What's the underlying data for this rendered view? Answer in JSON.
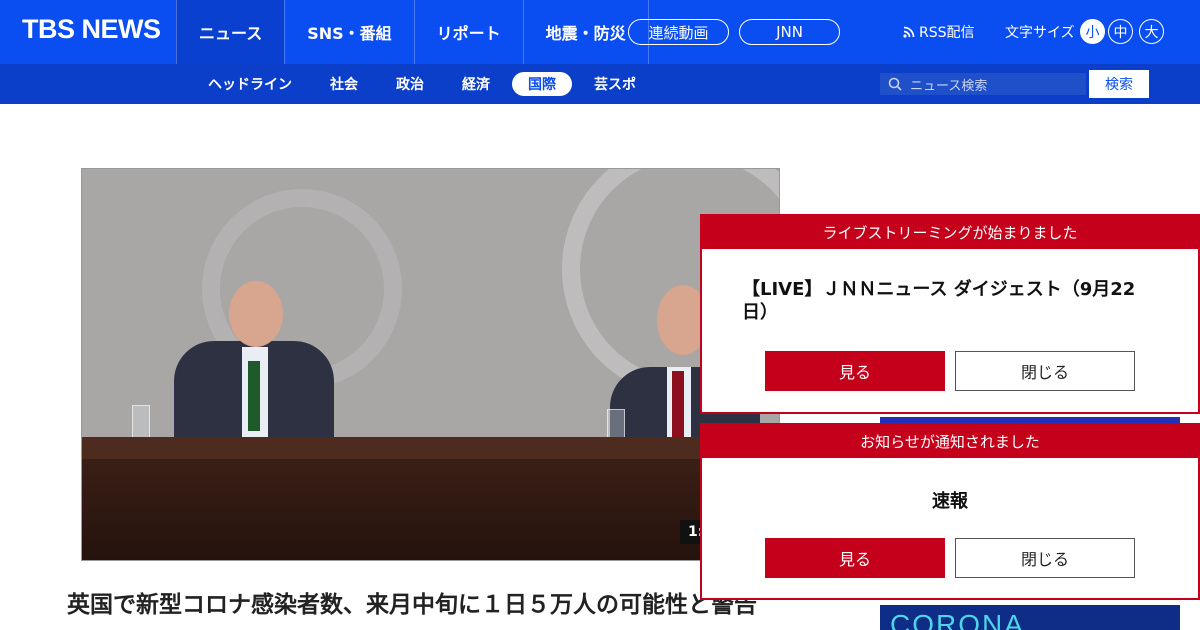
{
  "header": {
    "logo": "TBS NEWS",
    "nav": [
      {
        "label": "ニュース",
        "active": true
      },
      {
        "label": "SNS・番組",
        "active": false
      },
      {
        "label": "リポート",
        "active": false
      },
      {
        "label": "地震・防災",
        "active": false
      }
    ],
    "pills": [
      "連続動画",
      "JNN"
    ],
    "rss_label": "RSS配信",
    "font_size_label": "文字サイズ",
    "font_sizes": [
      "小",
      "中",
      "大"
    ],
    "font_size_selected": "小",
    "brand_color": "#0a4df0"
  },
  "subnav": {
    "items": [
      "ヘッドライン",
      "社会",
      "政治",
      "経済",
      "国際",
      "芸スポ"
    ],
    "active": "国際",
    "search_placeholder": "ニュース検索",
    "search_button": "検索"
  },
  "article": {
    "video_time": "1:",
    "headline": "英国で新型コロナ感染者数、来月中旬に１日５万人の可能性と警告"
  },
  "popups": [
    {
      "header": "ライブストリーミングが始まりました",
      "title": "【LIVE】ＪＮＮニュース ダイジェスト（9月22日）",
      "view_label": "見る",
      "close_label": "閉じる"
    },
    {
      "header": "お知らせが通知されました",
      "title": "速報",
      "view_label": "見る",
      "close_label": "閉じる"
    }
  ],
  "ads": {
    "corona_text": "CORONA"
  },
  "colors": {
    "accent_red": "#c4001a",
    "subnav_blue": "#0b3fc9"
  }
}
